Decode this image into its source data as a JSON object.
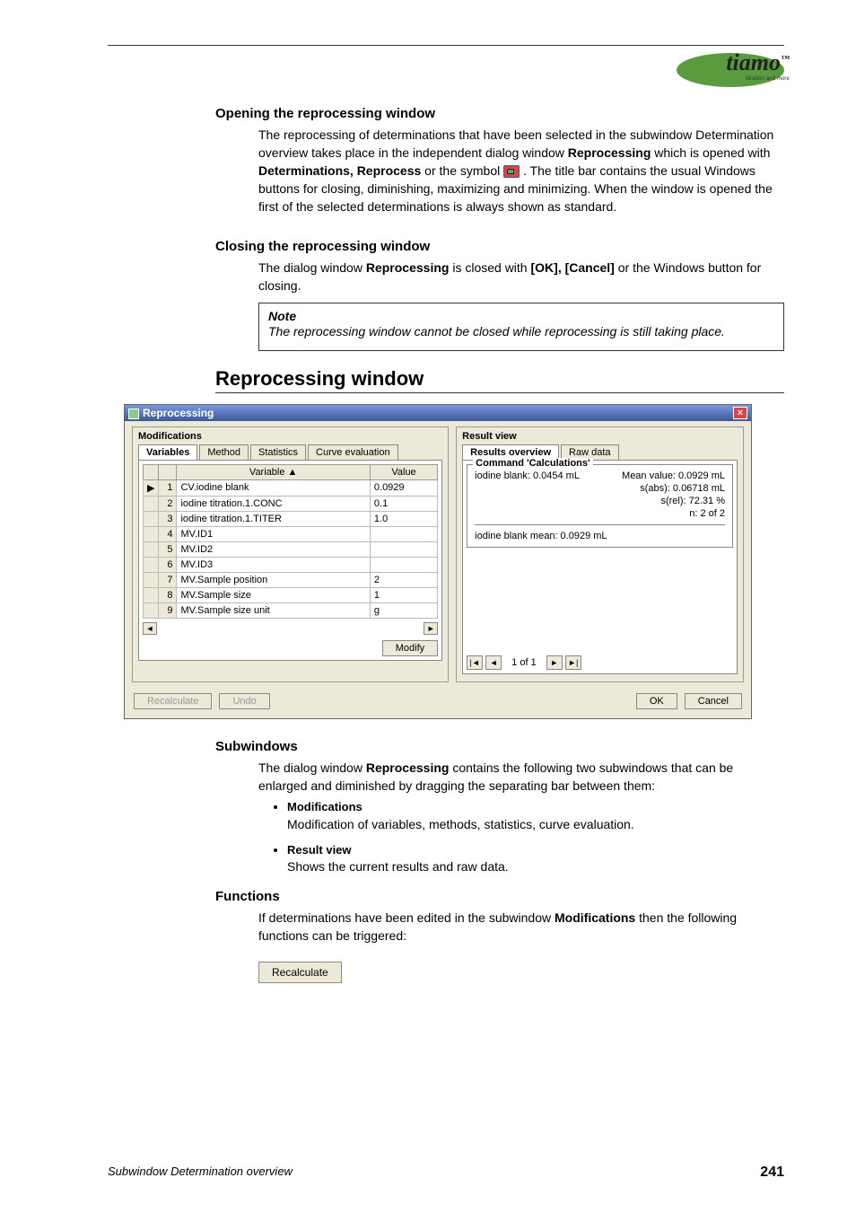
{
  "logo": {
    "brand": "tiamo",
    "tag": "titration and more",
    "tm": "™"
  },
  "sec1": {
    "title": "Opening the reprocessing window",
    "p1a": "The reprocessing of determinations that have been selected in the subwindow Determination overview takes place in the independent dialog window ",
    "p1b": "Reprocessing",
    "p2a": "which is opened with ",
    "p2b": "Determinations, Reprocess",
    "p2c": " or the symbol ",
    "p2d": " . The title bar contains the usual Windows buttons for closing, diminishing, maximizing and minimizing. When the window is opened the first of the selected determinations is always shown as standard."
  },
  "sec2": {
    "title": "Closing the reprocessing window",
    "p1a": "The dialog window ",
    "p1b": "Reprocessing",
    "p1c": " is closed with ",
    "p1d": "[OK], [Cancel]",
    "p1e": " or the Windows button for closing."
  },
  "note": {
    "title": "Note",
    "body": "The reprocessing window cannot be closed while reprocessing is still taking place."
  },
  "sec3": {
    "title": "Reprocessing window"
  },
  "dlg": {
    "title": "Reprocessing",
    "left": {
      "title": "Modifications",
      "tabs": [
        "Variables",
        "Method",
        "Statistics",
        "Curve evaluation"
      ],
      "col_var": "Variable ▲",
      "col_val": "Value",
      "rows": [
        {
          "n": "1",
          "ind": "▶",
          "var": "CV.iodine blank",
          "val": "0.0929"
        },
        {
          "n": "2",
          "ind": "",
          "var": "iodine titration.1.CONC",
          "val": "0.1"
        },
        {
          "n": "3",
          "ind": "",
          "var": "iodine titration.1.TITER",
          "val": "1.0"
        },
        {
          "n": "4",
          "ind": "",
          "var": "MV.ID1",
          "val": ""
        },
        {
          "n": "5",
          "ind": "",
          "var": "MV.ID2",
          "val": ""
        },
        {
          "n": "6",
          "ind": "",
          "var": "MV.ID3",
          "val": ""
        },
        {
          "n": "7",
          "ind": "",
          "var": "MV.Sample position",
          "val": "2"
        },
        {
          "n": "8",
          "ind": "",
          "var": "MV.Sample size",
          "val": "1"
        },
        {
          "n": "9",
          "ind": "",
          "var": "MV.Sample size unit",
          "val": "g"
        }
      ],
      "modify": "Modify"
    },
    "right": {
      "title": "Result view",
      "tabs": [
        "Results overview",
        "Raw data"
      ],
      "group_title": "Command 'Calculations'",
      "line1_l": "iodine blank:  0.0454 mL",
      "line1_r": "Mean value:  0.0929 mL",
      "line2_r": "s(abs):  0.06718 mL",
      "line3_r": "s(rel):  72.31 %",
      "line4_r": "n:  2 of 2",
      "mean_line": "iodine blank mean:  0.0929 mL",
      "pager": "1 of 1"
    },
    "footer": {
      "recalc": "Recalculate",
      "undo": "Undo",
      "ok": "OK",
      "cancel": "Cancel"
    }
  },
  "sec4": {
    "title": "Subwindows",
    "p1a": "The dialog window ",
    "p1b": "Reprocessing",
    "p1c": " contains the following two subwindows that can be enlarged and diminished by dragging the separating bar between them:",
    "b1t": "Modifications",
    "b1d": "Modification of variables, methods, statistics, curve evaluation.",
    "b2t": "Result view",
    "b2d": "Shows the current results and raw data."
  },
  "sec5": {
    "title": "Functions",
    "p1a": "If determinations have been edited in the subwindow ",
    "p1b": "Modifications",
    "p1c": " then the following functions can be triggered:",
    "btn": "Recalculate"
  },
  "footer": {
    "left": "Subwindow Determination overview",
    "right": "241"
  }
}
